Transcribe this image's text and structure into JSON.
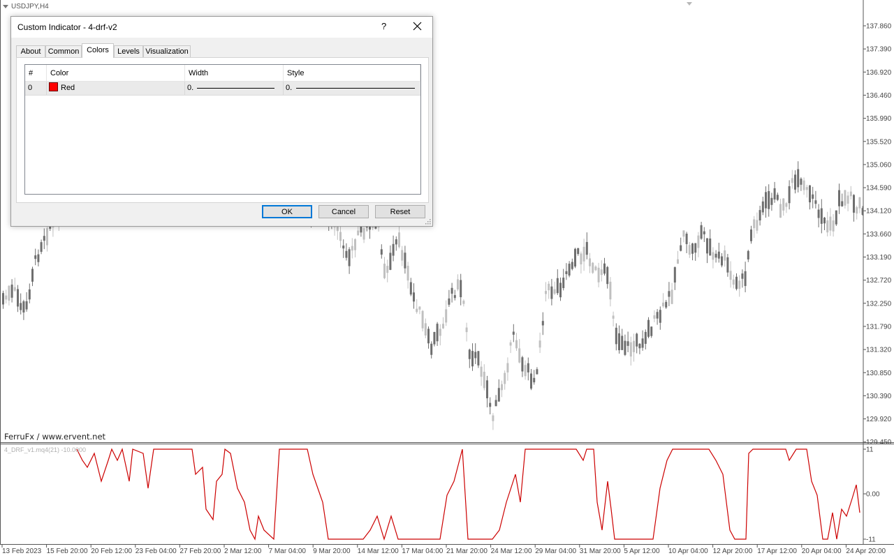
{
  "chart": {
    "symbol": "USDJPY,H4",
    "credit": "FerruFx / www.ervent.net",
    "indicator_label": "4_DRF_v1.mq4(21) -10.0000",
    "price_axis": [
      "137.860",
      "137.390",
      "136.920",
      "136.460",
      "135.990",
      "135.520",
      "135.060",
      "134.590",
      "134.120",
      "133.660",
      "133.190",
      "132.720",
      "132.250",
      "131.790",
      "131.320",
      "130.850",
      "130.390",
      "129.920",
      "129.450"
    ],
    "indicator_axis": [
      "11",
      "0.00",
      "-11"
    ],
    "time_axis": [
      "13 Feb 2023",
      "15 Feb 20:00",
      "20 Feb 12:00",
      "23 Feb 04:00",
      "27 Feb 20:00",
      "2 Mar 12:00",
      "7 Mar 04:00",
      "9 Mar 20:00",
      "14 Mar 12:00",
      "17 Mar 04:00",
      "21 Mar 20:00",
      "24 Mar 12:00",
      "29 Mar 04:00",
      "31 Mar 20:00",
      "5 Apr 12:00",
      "10 Apr 04:00",
      "12 Apr 20:00",
      "17 Apr 12:00",
      "20 Apr 04:00",
      "24 Apr 20:00"
    ],
    "colors": {
      "candle_bull": "#c0c0c0",
      "candle_bear": "#6e6e6e",
      "indicator_line": "#cc0000",
      "grid": "#d0d0d0"
    }
  },
  "dialog": {
    "title": "Custom Indicator - 4-drf-v2",
    "help": "?",
    "tabs": [
      "About",
      "Common",
      "Colors",
      "Levels",
      "Visualization"
    ],
    "active_tab": "Colors",
    "grid_headers": [
      "#",
      "Color",
      "Width",
      "Style"
    ],
    "rows": [
      {
        "index": "0",
        "color_name": "Red",
        "color_hex": "#ff0000",
        "width": "0.",
        "style": "0."
      }
    ],
    "buttons": {
      "ok": "OK",
      "cancel": "Cancel",
      "reset": "Reset"
    }
  }
}
